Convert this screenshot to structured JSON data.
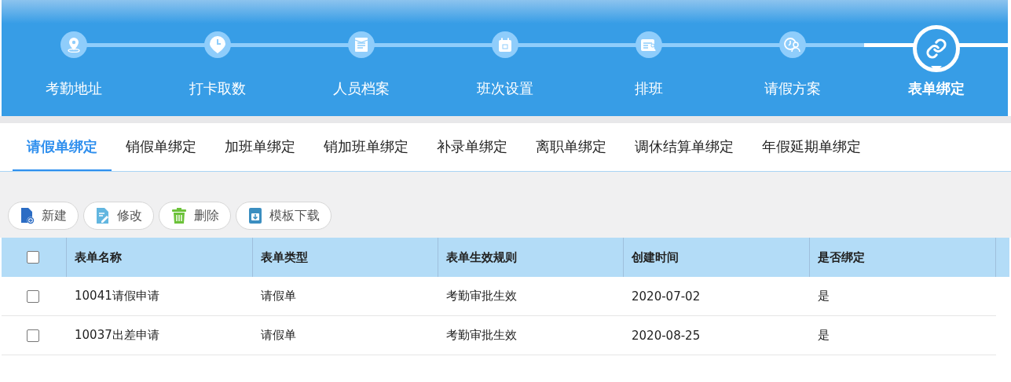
{
  "steps": [
    {
      "label": "考勤地址",
      "selected": false
    },
    {
      "label": "打卡取数",
      "selected": false
    },
    {
      "label": "人员档案",
      "selected": false
    },
    {
      "label": "班次设置",
      "selected": false
    },
    {
      "label": "排班",
      "selected": false
    },
    {
      "label": "请假方案",
      "selected": false
    },
    {
      "label": "表单绑定",
      "selected": true
    }
  ],
  "tabs": [
    {
      "label": "请假单绑定",
      "selected": true
    },
    {
      "label": "销假单绑定",
      "selected": false
    },
    {
      "label": "加班单绑定",
      "selected": false
    },
    {
      "label": "销加班单绑定",
      "selected": false
    },
    {
      "label": "补录单绑定",
      "selected": false
    },
    {
      "label": "离职单绑定",
      "selected": false
    },
    {
      "label": "调休结算单绑定",
      "selected": false
    },
    {
      "label": "年假延期单绑定",
      "selected": false
    }
  ],
  "toolbar": [
    {
      "label": "新建",
      "kind": "new"
    },
    {
      "label": "修改",
      "kind": "edit"
    },
    {
      "label": "删除",
      "kind": "delete"
    },
    {
      "label": "模板下载",
      "kind": "download"
    }
  ],
  "table": {
    "all_checked": false,
    "columns": [
      "表单名称",
      "表单类型",
      "表单生效规则",
      "创建时间",
      "是否绑定"
    ],
    "rows": [
      {
        "checked": false,
        "cells": [
          "10041请假申请",
          "请假单",
          "考勤审批生效",
          "2020-07-02",
          "是"
        ]
      },
      {
        "checked": false,
        "cells": [
          "10037出差申请",
          "请假单",
          "考勤审批生效",
          "2020-08-25",
          "是"
        ]
      }
    ]
  }
}
